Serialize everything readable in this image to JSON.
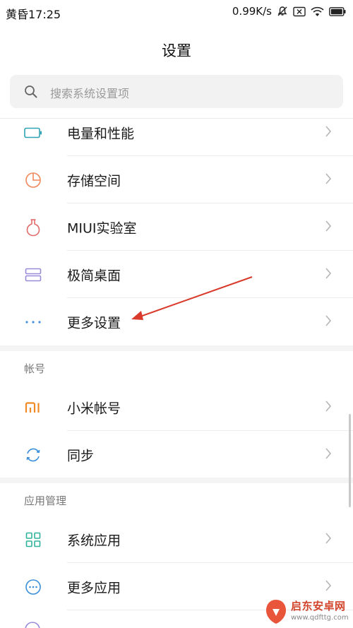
{
  "status_bar": {
    "time": "黄昏17:25",
    "network_speed": "0.99K/s",
    "icons": [
      "mute-icon",
      "sim-icon",
      "wifi-icon",
      "battery-icon"
    ]
  },
  "page": {
    "title": "设置"
  },
  "search": {
    "placeholder": "搜索系统设置项"
  },
  "groups": [
    {
      "items": [
        {
          "label": "电量和性能",
          "icon": "battery-outline-icon",
          "color": "#2fa3b4"
        },
        {
          "label": "存储空间",
          "icon": "pie-chart-icon",
          "color": "#f0885a"
        },
        {
          "label": "MIUI实验室",
          "icon": "flask-icon",
          "color": "#e36b6b"
        },
        {
          "label": "极简桌面",
          "icon": "layout-icon",
          "color": "#9a8ad9"
        },
        {
          "label": "更多设置",
          "icon": "more-dots-icon",
          "color": "#4a8fd9"
        }
      ]
    },
    {
      "header": "帐号",
      "items": [
        {
          "label": "小米帐号",
          "icon": "mi-logo-icon",
          "color": "#f08a24"
        },
        {
          "label": "同步",
          "icon": "sync-icon",
          "color": "#3a8fd9"
        }
      ]
    },
    {
      "header": "应用管理",
      "items": [
        {
          "label": "系统应用",
          "icon": "grid-icon",
          "color": "#2fb39a"
        },
        {
          "label": "更多应用",
          "icon": "more-circle-icon",
          "color": "#3a8fd9"
        }
      ]
    }
  ],
  "watermark": {
    "name": "启东安卓网",
    "url": "www.qdfttg.com"
  }
}
